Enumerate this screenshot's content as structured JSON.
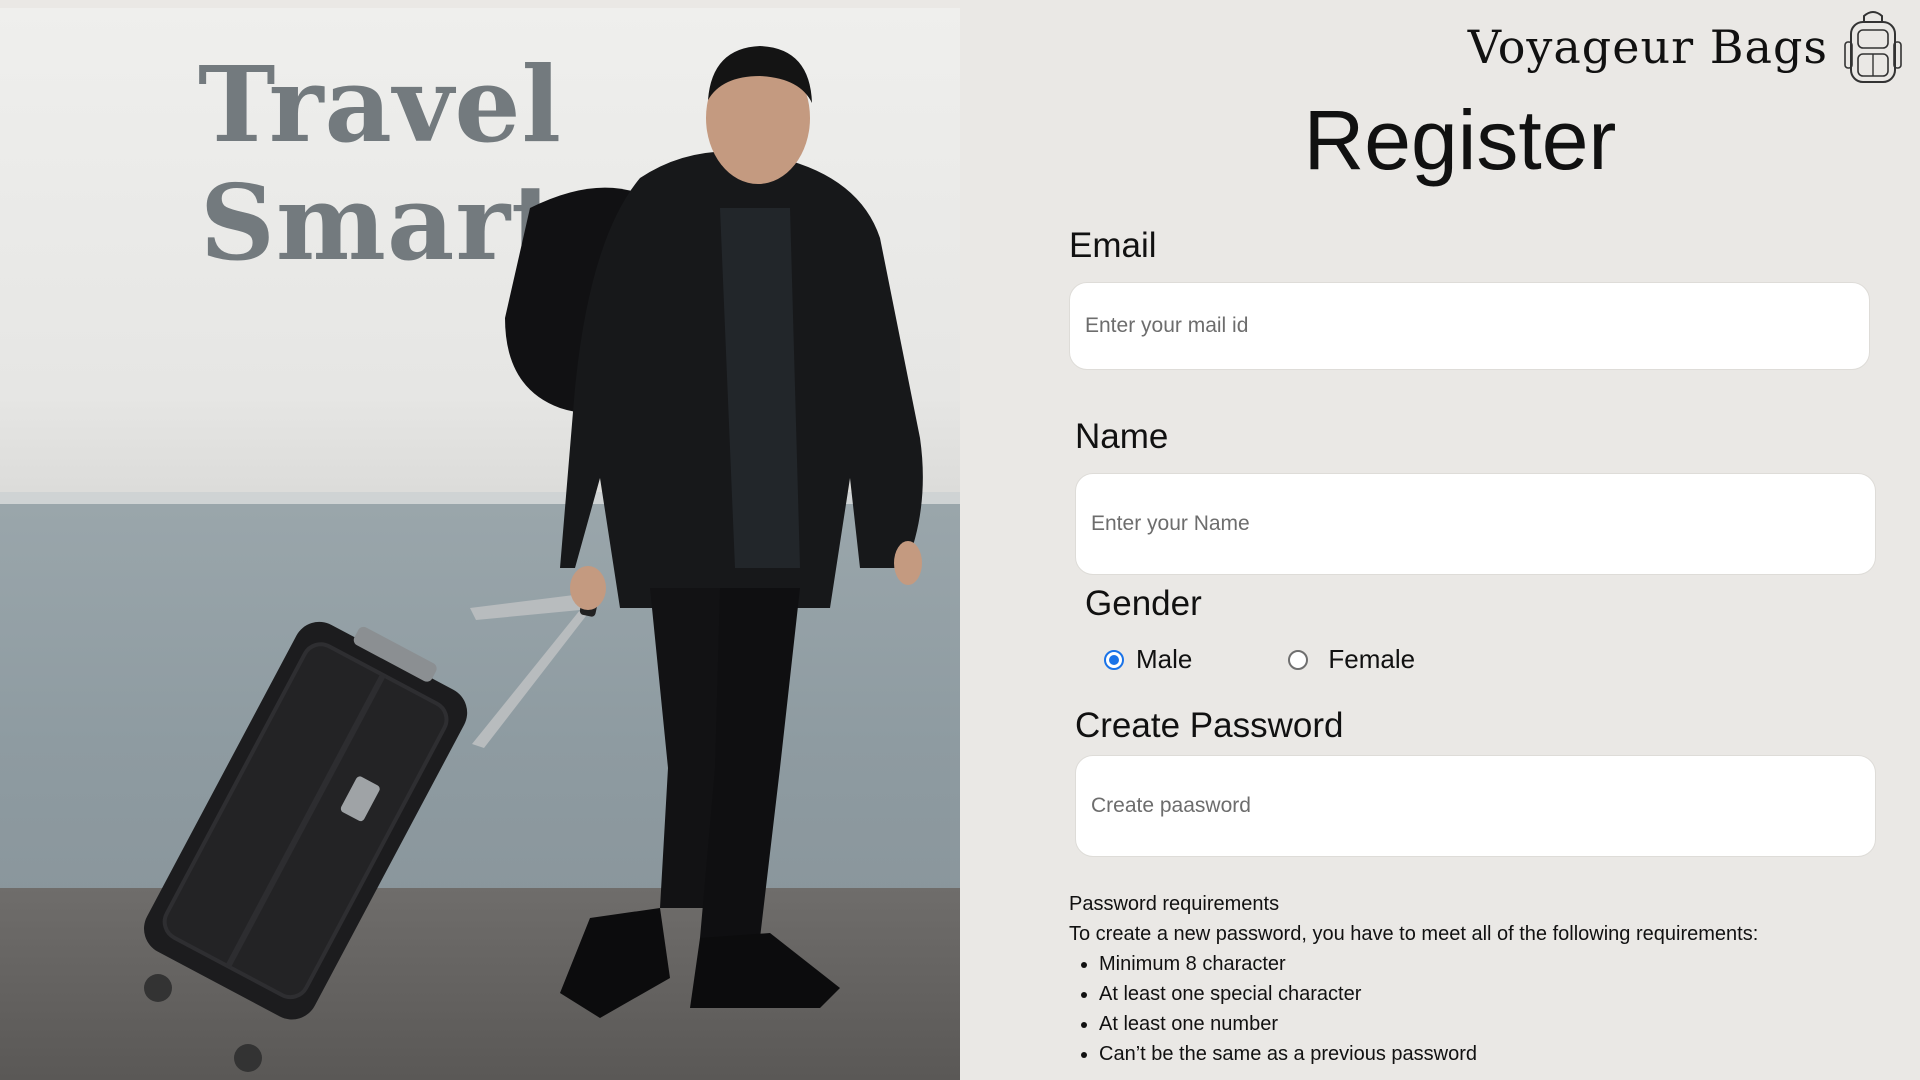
{
  "brand": {
    "name": "Voyageur Bags",
    "logo_icon": "backpack-icon"
  },
  "hero": {
    "tagline_line1": "Travel",
    "tagline_line2": "Smart"
  },
  "form": {
    "title": "Register",
    "email": {
      "label": "Email",
      "placeholder": "Enter your mail id",
      "value": ""
    },
    "name": {
      "label": "Name",
      "placeholder": "Enter your Name",
      "value": ""
    },
    "gender": {
      "label": "Gender",
      "options": [
        {
          "label": "Male",
          "selected": true
        },
        {
          "label": "Female",
          "selected": false
        }
      ]
    },
    "password": {
      "label": "Create Password",
      "placeholder": "Create paasword",
      "value": ""
    },
    "requirements": {
      "heading": "Password requirements",
      "intro": "To create a new password, you have to meet all of the following requirements:",
      "items": [
        "Minimum 8 character",
        "At least one special character",
        "At least one number",
        "Can’t be the same as a previous password"
      ]
    }
  },
  "colors": {
    "background": "#eae8e5",
    "accent": "#1a73e8",
    "tagline": "#737a7e"
  }
}
